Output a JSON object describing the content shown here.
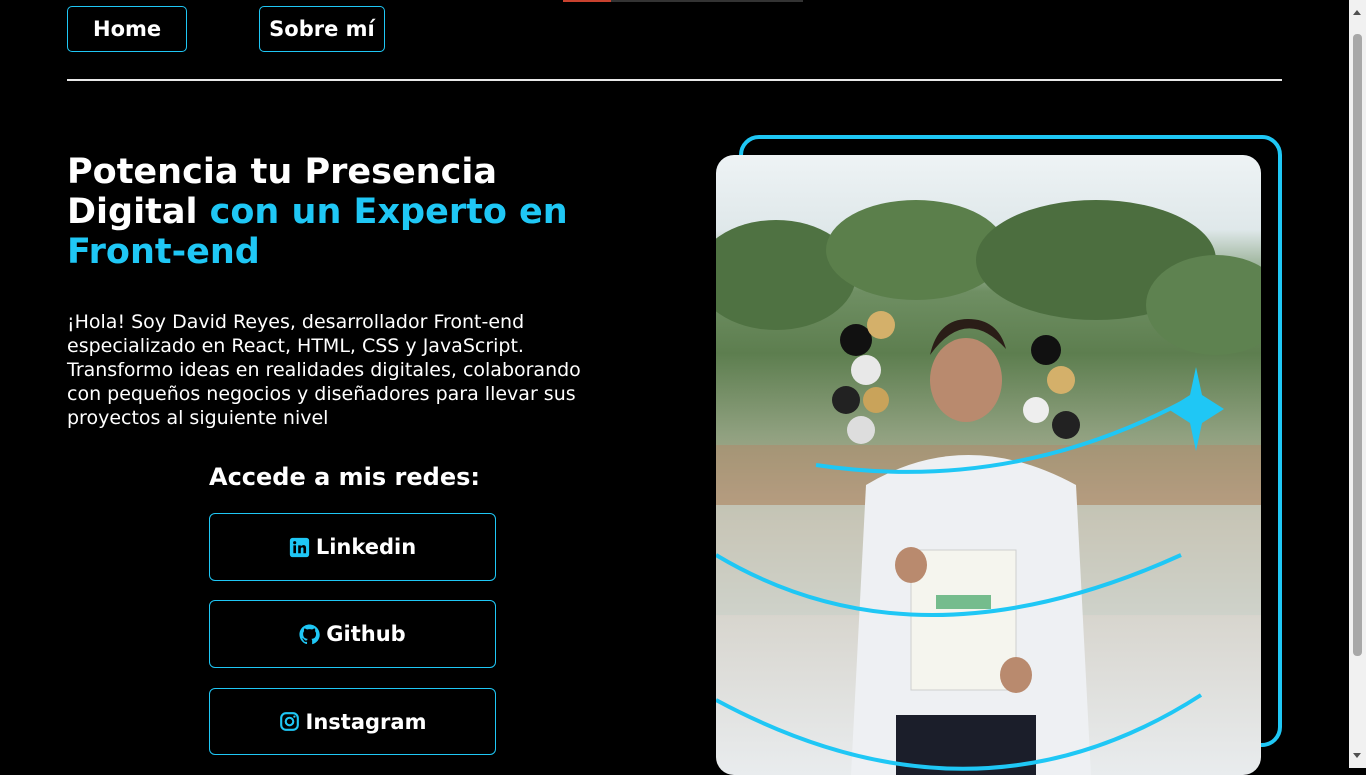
{
  "nav": {
    "home_label": "Home",
    "about_label": "Sobre mí"
  },
  "hero": {
    "title_white": "Potencia tu Presencia Digital",
    "title_accent": "con un Experto en Front-end",
    "intro": "¡Hola! Soy David Reyes, desarrollador Front-end especializado en React, HTML, CSS y JavaScript. Transformo ideas en realidades digitales, colaborando con pequeños negocios y diseñadores para llevar sus proyectos al siguiente nivel"
  },
  "social": {
    "heading": "Accede a mis redes:",
    "links": [
      {
        "label": "Linkedin",
        "icon": "linkedin-icon"
      },
      {
        "label": "Github",
        "icon": "github-icon"
      },
      {
        "label": "Instagram",
        "icon": "instagram-icon"
      }
    ]
  },
  "colors": {
    "accent": "#1fc7f5",
    "background": "#000000",
    "text": "#ffffff"
  },
  "photo": {
    "icon": "portrait-photo"
  }
}
